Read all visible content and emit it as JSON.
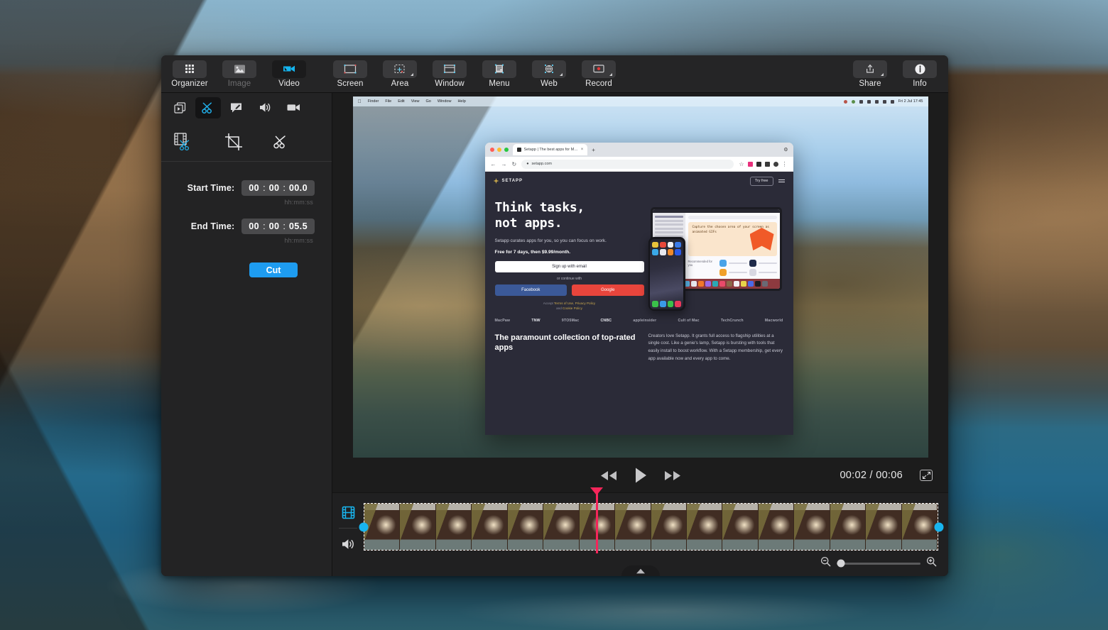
{
  "toolbar": {
    "left_items": [
      {
        "label": "Organizer",
        "icon": "grid-icon",
        "state": "normal"
      },
      {
        "label": "Image",
        "icon": "image-icon",
        "state": "disabled"
      },
      {
        "label": "Video",
        "icon": "video-camera-icon",
        "state": "active"
      }
    ],
    "capture_items": [
      {
        "label": "Screen",
        "icon": "screen-capture-icon"
      },
      {
        "label": "Area",
        "icon": "area-capture-icon"
      },
      {
        "label": "Window",
        "icon": "window-capture-icon"
      },
      {
        "label": "Menu",
        "icon": "menu-capture-icon"
      },
      {
        "label": "Web",
        "icon": "web-capture-icon"
      },
      {
        "label": "Record",
        "icon": "record-icon"
      }
    ],
    "right_items": [
      {
        "label": "Share",
        "icon": "share-icon"
      },
      {
        "label": "Info",
        "icon": "info-icon"
      }
    ]
  },
  "sidebar": {
    "tool_tabs": [
      {
        "name": "clips-icon",
        "active": false
      },
      {
        "name": "scissors-icon",
        "active": true
      },
      {
        "name": "annotate-icon",
        "active": false
      },
      {
        "name": "audio-icon",
        "active": false
      },
      {
        "name": "camera-icon",
        "active": false
      }
    ],
    "sub_tabs": [
      {
        "name": "split-filmstrip-icon",
        "active": true
      },
      {
        "name": "crop-icon",
        "active": false
      },
      {
        "name": "trim-scissors-icon",
        "active": false
      }
    ],
    "start_time": {
      "label": "Start Time:",
      "hours": "00",
      "minutes": "00",
      "seconds": "00.0",
      "hint": "hh:mm:ss"
    },
    "end_time": {
      "label": "End Time:",
      "hours": "00",
      "minutes": "00",
      "seconds": "05.5",
      "hint": "hh:mm:ss"
    },
    "cut_button": "Cut",
    "accent_color": "#1e9cf0"
  },
  "preview": {
    "menubar": {
      "apple": "",
      "items": [
        "Finder",
        "File",
        "Edit",
        "View",
        "Go",
        "Window",
        "Help"
      ],
      "clock": "Fri 2 Jul 17:45"
    },
    "browser": {
      "tab_title": "Setapp | The best apps for M…",
      "tab_close": "×",
      "new_tab": "+",
      "back": "←",
      "forward": "→",
      "reload": "↻",
      "lock": "🔒",
      "url": "setapp.com",
      "star": "☆",
      "menu": "⋮",
      "settings": "⚙"
    },
    "setapp": {
      "brand": "SETAPP",
      "try_free": "Try free",
      "headline_line1": "Think tasks,",
      "headline_line2": "not apps.",
      "subhead": "Setapp curates apps for you, so you can focus on work.",
      "price": "Free for 7 days, then $9.99/month.",
      "email_button": "Sign up with email",
      "or_continue": "or continue with",
      "facebook": "Facebook",
      "google": "Google",
      "terms_line1_prefix": "Accept ",
      "terms_link1": "Terms of Use",
      "terms_link2": "Privacy Policy",
      "terms_line2_prefix": "and ",
      "terms_link3": "Cookie Policy",
      "press_logos": [
        "MacPaw",
        "TNW",
        "9TO5Mac",
        "CNBC",
        "appleinsider",
        "Cult of Mac",
        "TechCrunch",
        "Macworld"
      ],
      "bottom_heading": "The paramount collection of top-rated apps",
      "bottom_paragraph": "Creators love Setapp. It grants full access to flagship utilities at a single cost. Like a genie's lamp, Setapp is bursting with tools that easily install to boost workflow. With a Setapp membership, get every app available now and every app to come.",
      "mock_banner_text": "Capture the chosen area of your screen as animated GIFs",
      "mock_recommended": "Recommended for you"
    }
  },
  "player": {
    "rewind": "rewind-icon",
    "play": "play-icon",
    "forward": "fast-forward-icon",
    "current_time": "00:02",
    "separator": "/",
    "total_time": "00:06",
    "time_display": "00:02 / 00:06",
    "fullscreen": "fullscreen-icon"
  },
  "timeline": {
    "video_track_icon": "video-track-icon",
    "audio_track_icon": "audio-track-icon",
    "selection_start_handle": "clip-start-handle",
    "selection_end_handle": "clip-end-handle",
    "playhead_color": "#f4265a",
    "handle_color": "#18b5ef",
    "zoom_out_icon": "zoom-out-icon",
    "zoom_in_icon": "zoom-in-icon",
    "zoom_level": 5,
    "collapse_icon": "chevron-up-icon"
  }
}
